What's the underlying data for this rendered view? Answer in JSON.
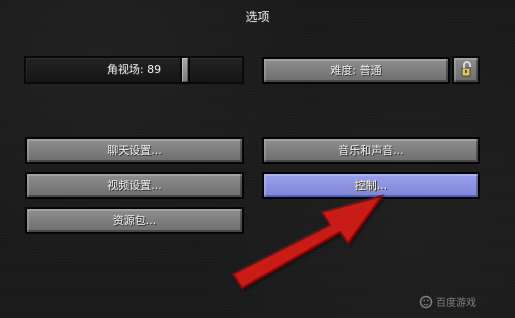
{
  "screen": {
    "title": "选项"
  },
  "options": {
    "fov_label": "角视场: 89",
    "fov_value": 89,
    "difficulty_label": "难度: 普通",
    "chat_settings": "聊天设置...",
    "music_sound": "音乐和声音...",
    "video_settings": "视频设置...",
    "controls": "控制...",
    "resource_packs": "资源包..."
  },
  "icons": {
    "lock": "lock-icon",
    "arrow": "red-arrow-icon"
  },
  "watermark": {
    "text": "百度游戏"
  },
  "colors": {
    "background": "#1b1b1b",
    "button": "#7c7c7c",
    "active_button": "#8f95e6",
    "active_text": "#ffffa8",
    "arrow": "#d11b14"
  }
}
